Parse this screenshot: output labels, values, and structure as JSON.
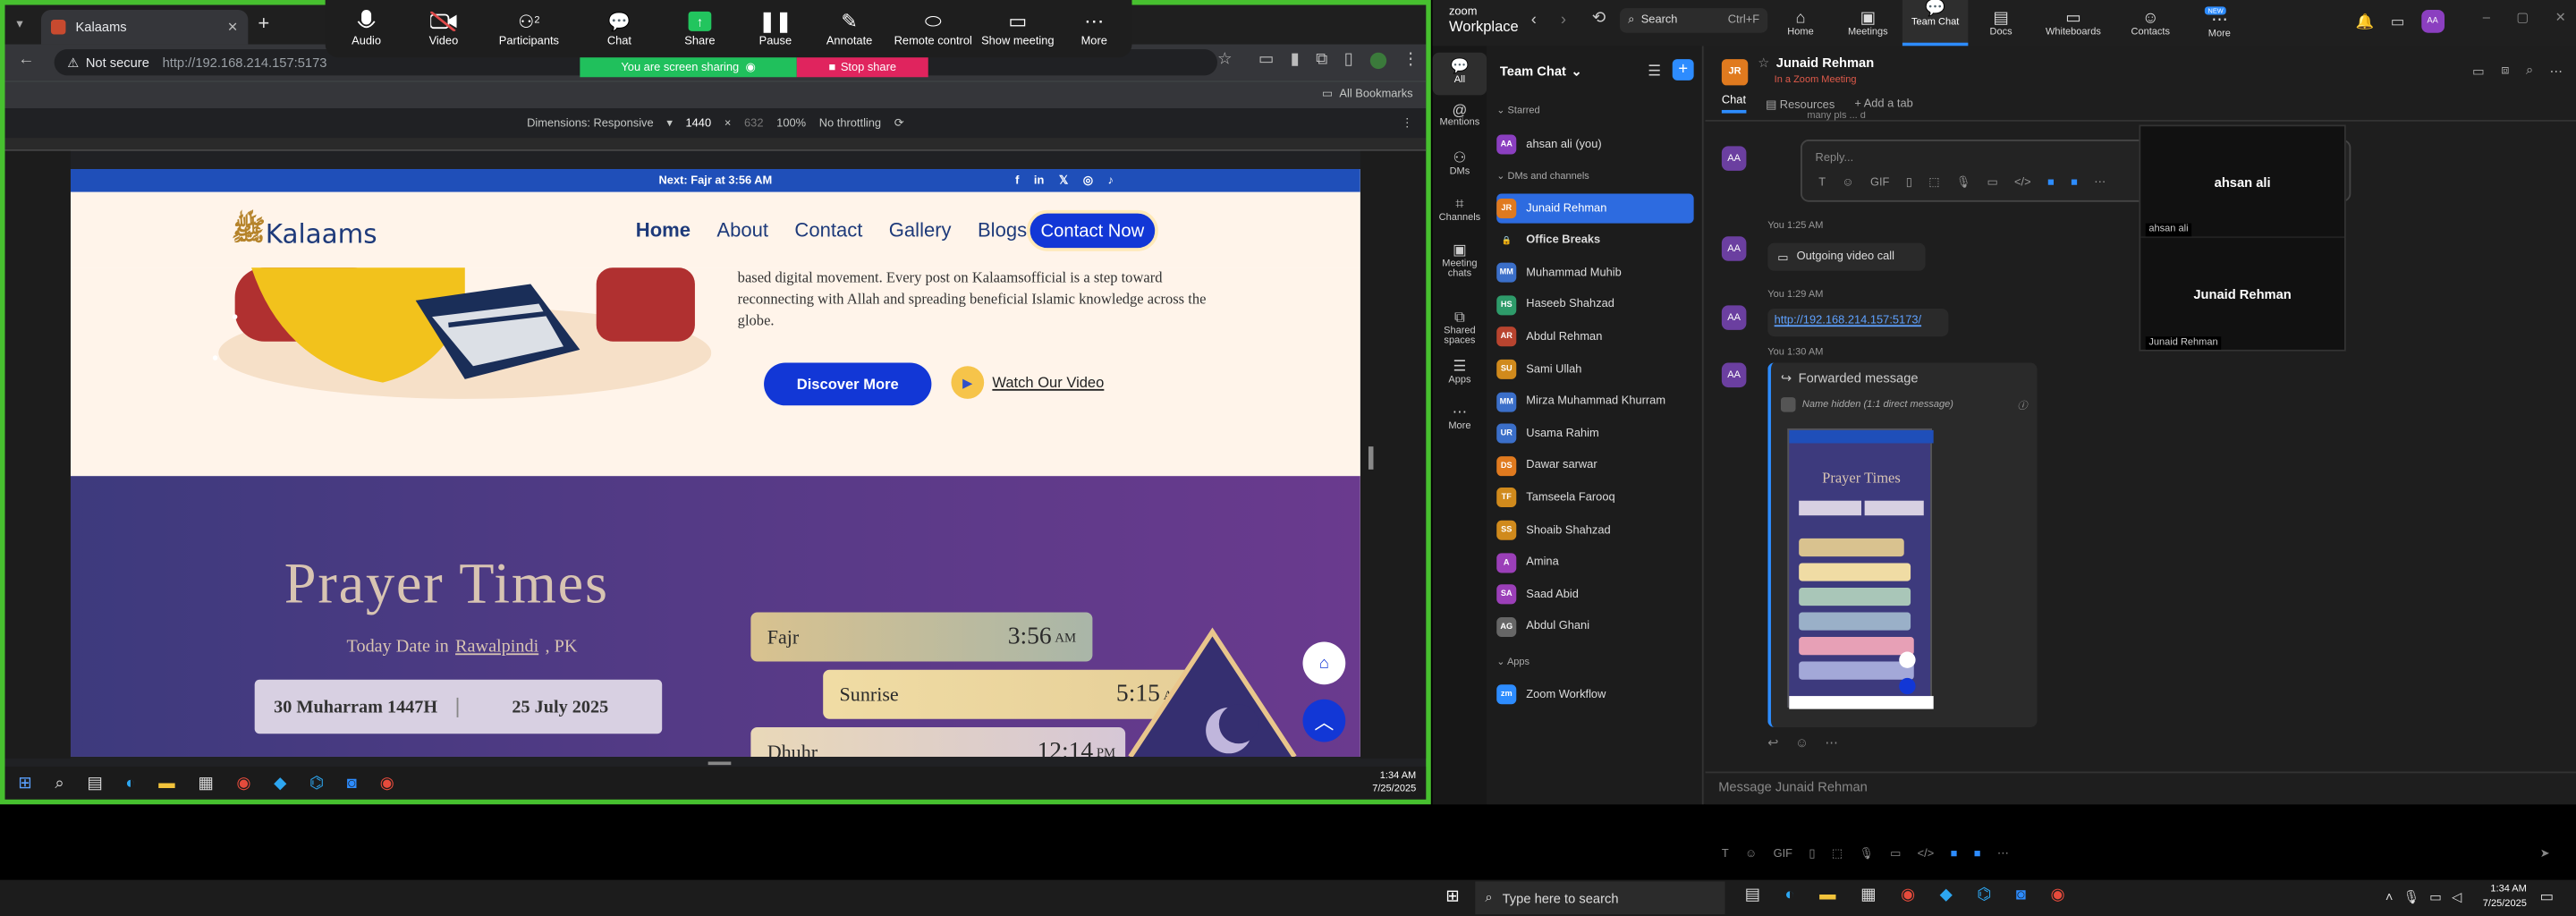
{
  "browser": {
    "tab_title": "Kalaams",
    "not_secure": "Not secure",
    "url": "http://192.168.214.157:5173",
    "bookmarks": "All Bookmarks"
  },
  "devtools": {
    "dimensions": "Dimensions: Responsive",
    "width": "1440",
    "x": "×",
    "height": "632",
    "zoom": "100%",
    "throttle": "No throttling"
  },
  "site": {
    "top_strip": "Next: Fajr at 3:56 AM",
    "logo": "Kalaams",
    "nav": [
      "Home",
      "About",
      "Contact",
      "Gallery",
      "Blogs"
    ],
    "contact_btn": "Contact Now",
    "hero_text": "based digital movement. Every post on Kalaamsofficial is a step toward reconnecting with Allah and spreading beneficial Islamic knowledge across the globe.",
    "discover": "Discover More",
    "watch": "Watch Our Video",
    "prayer_title": "Prayer Times",
    "today_prefix": "Today Date in",
    "city": "Rawalpindi",
    "country": ", PK",
    "hijri": "30 Muharram 1447H",
    "gregorian": "25 July 2025",
    "prayers": [
      {
        "name": "Fajr",
        "time": "3:56",
        "ampm": "AM",
        "color": "#d9c28f"
      },
      {
        "name": "Sunrise",
        "time": "5:15",
        "ampm": "AM",
        "color": "#f0dca4"
      },
      {
        "name": "Dhuhr",
        "time": "12:14",
        "ampm": "PM",
        "color": "#e9d8b8"
      }
    ]
  },
  "zoom_toolbar": {
    "items": [
      "Audio",
      "Video",
      "Participants",
      "Chat",
      "Share",
      "Pause",
      "Annotate",
      "Remote control",
      "Show meeting",
      "More"
    ],
    "participants_count": "2",
    "sharing": "You are screen sharing",
    "stop": "Stop share"
  },
  "left_taskbar": {
    "time": "1:34 AM",
    "date": "7/25/2025"
  },
  "zoom": {
    "logo_top": "zoom",
    "logo_bottom": "Workplace",
    "search": "Search",
    "shortcut": "Ctrl+F",
    "tabs": [
      "Home",
      "Meetings",
      "Team Chat",
      "Docs",
      "Whiteboards",
      "Contacts",
      "More"
    ],
    "new_badge": "NEW",
    "rail": [
      "All",
      "Mentions",
      "DMs",
      "Channels",
      "Meeting chats",
      "Shared spaces",
      "Apps",
      "More"
    ],
    "panel_title": "Team Chat",
    "starred": "Starred",
    "me": "ahsan ali (you)",
    "dms_channels": "DMs and channels",
    "contacts": [
      {
        "name": "Junaid Rehman",
        "init": "JR",
        "c": "#e07a1f",
        "sel": true
      },
      {
        "name": "Office Breaks",
        "init": "🔒",
        "c": "#1c1c1c",
        "bold": true
      },
      {
        "name": "Muhammad Muhib",
        "init": "MM",
        "c": "#3b6fc9"
      },
      {
        "name": "Haseeb Shahzad",
        "init": "HS",
        "c": "#2e9b6a"
      },
      {
        "name": "Abdul Rehman",
        "init": "AR",
        "c": "#b8442f"
      },
      {
        "name": "Sami Ullah",
        "init": "SU",
        "c": "#d08a1c"
      },
      {
        "name": "Mirza Muhammad Khurram",
        "init": "MM",
        "c": "#3b6fc9"
      },
      {
        "name": "Usama Rahim",
        "init": "UR",
        "c": "#3b6fc9"
      },
      {
        "name": "Dawar sarwar",
        "init": "DS",
        "c": "#e07a1f"
      },
      {
        "name": "Tamseela Farooq",
        "init": "TF",
        "c": "#d08a1c"
      },
      {
        "name": "Shoaib Shahzad",
        "init": "SS",
        "c": "#d08a1c"
      },
      {
        "name": "Amina",
        "init": "A",
        "c": "#9b3fb8"
      },
      {
        "name": "Saad Abid",
        "init": "SA",
        "c": "#9b3fb8"
      },
      {
        "name": "Abdul Ghani",
        "init": "AG",
        "c": "#666"
      }
    ],
    "apps_label": "Apps",
    "workflow": "Zoom Workflow",
    "chat_name": "Junaid Rehman",
    "chat_status": "In a Zoom Meeting",
    "chat_tabs": [
      "Chat",
      "Resources",
      "Add a tab"
    ],
    "reply": "Reply...",
    "partial": "many pls ... d",
    "msgs": [
      {
        "time": "You 1:25 AM",
        "text": "Outgoing video call"
      },
      {
        "time": "You 1:29 AM",
        "text": "http://192.168.214.157:5173/"
      },
      {
        "time": "You 1:30 AM",
        "fwd": "Forwarded message",
        "hidden": "Name hidden (1:1 direct message)"
      }
    ],
    "input_ph": "Message Junaid Rehman",
    "video": {
      "p1": "ahsan ali",
      "p1s": "ahsan ali",
      "p2": "Junaid Rehman",
      "p2s": "Junaid Rehman"
    }
  },
  "win_taskbar": {
    "search": "Type here to search",
    "time": "1:34 AM",
    "date": "7/25/2025"
  }
}
